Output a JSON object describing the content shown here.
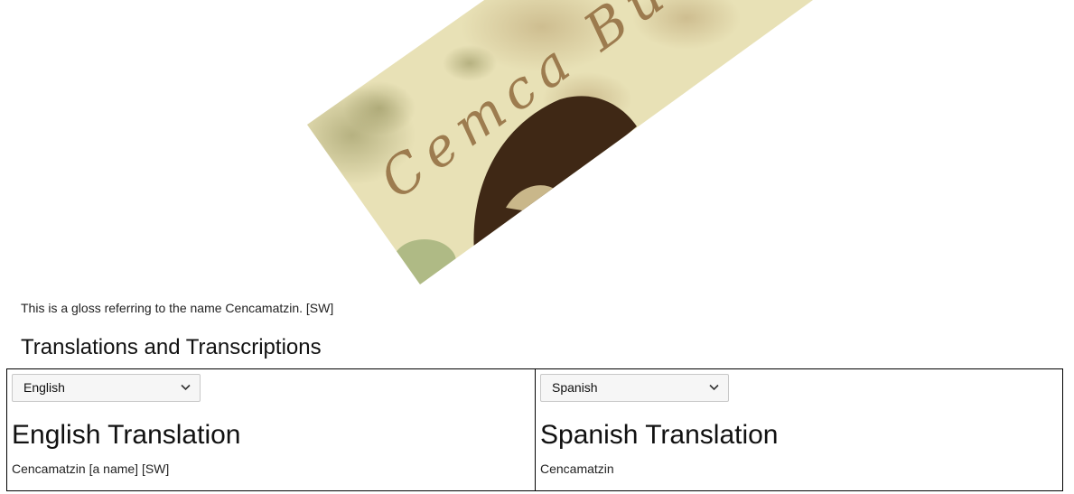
{
  "image": {
    "gloss_text": "Cemca Bu",
    "background_color": "#e9e2b8",
    "ink_color": "#8f6a3d",
    "hair_color": "#3f2815"
  },
  "caption": "This is a gloss referring to the name Cencamatzin. [SW]",
  "section": {
    "title": "Translations and Transcriptions"
  },
  "translations": [
    {
      "selected_language": "English",
      "heading": "English Translation",
      "text": "Cencamatzin [a name] [SW]"
    },
    {
      "selected_language": "Spanish",
      "heading": "Spanish Translation",
      "text": "Cencamatzin"
    }
  ],
  "icons": {
    "select_chevron": "chevron-down-icon"
  }
}
